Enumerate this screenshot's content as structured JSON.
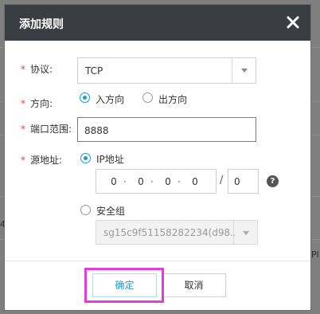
{
  "modal": {
    "title": "添加规则",
    "close_icon": "close-icon"
  },
  "form": {
    "protocol": {
      "label": "协议:",
      "value": "TCP",
      "required_mark": "*"
    },
    "direction": {
      "label": "方向:",
      "required_mark": "*",
      "options": [
        {
          "label": "入方向",
          "checked": true
        },
        {
          "label": "出方向",
          "checked": false
        }
      ]
    },
    "port_range": {
      "label": "端口范围:",
      "required_mark": "*",
      "value": "8888"
    },
    "source": {
      "label": "源地址:",
      "required_mark": "*",
      "ip_option": {
        "label": "IP地址",
        "checked": true
      },
      "ip_segments": [
        "0",
        "0",
        "0",
        "0"
      ],
      "ip_dot": "·",
      "slash": "/",
      "mask": "0",
      "help_icon": "?",
      "sg_option": {
        "label": "安全组",
        "checked": false
      },
      "sg_value": "sg15c9f51158282234(d98..."
    }
  },
  "footer": {
    "confirm_label": "确定",
    "cancel_label": "取消"
  },
  "background": {
    "left_fragment": "4",
    "right_fragment": "Pl"
  },
  "colors": {
    "header_bg": "#3a3d42",
    "accent": "#1e9ad6",
    "required": "#e8463c",
    "highlight": "#e23be0"
  }
}
